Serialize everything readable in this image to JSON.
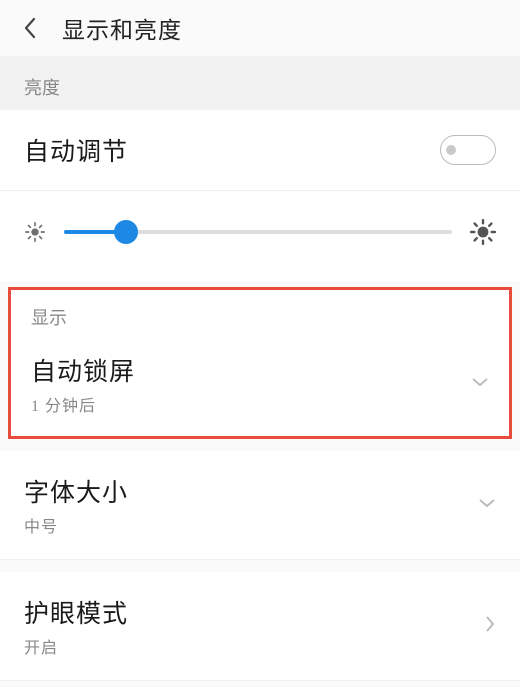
{
  "header": {
    "title": "显示和亮度"
  },
  "sections": {
    "brightness_label": "亮度",
    "display_label": "显示"
  },
  "autoAdjust": {
    "title": "自动调节",
    "enabled": false
  },
  "brightnessSlider": {
    "percent": 16
  },
  "autoLock": {
    "title": "自动锁屏",
    "subtitle": "1 分钟后"
  },
  "fontSize": {
    "title": "字体大小",
    "subtitle": "中号"
  },
  "eyeProtect": {
    "title": "护眼模式",
    "subtitle": "开启"
  }
}
